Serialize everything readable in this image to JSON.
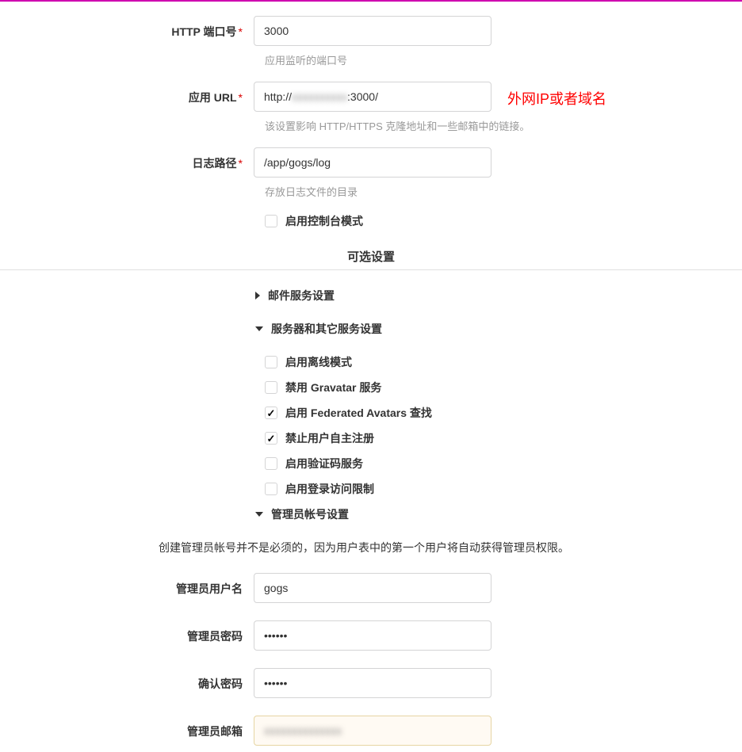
{
  "fields": {
    "http_port": {
      "label": "HTTP 端口号",
      "value": "3000",
      "help": "应用监听的端口号"
    },
    "app_url": {
      "label": "应用 URL",
      "prefix": "http://",
      "blurred": "xxxxxxxxxx",
      "suffix": ":3000/",
      "help": "该设置影响 HTTP/HTTPS 克隆地址和一些邮箱中的链接。",
      "annotation": "外网IP或者域名"
    },
    "log_path": {
      "label": "日志路径",
      "value": "/app/gogs/log",
      "help": "存放日志文件的目录"
    },
    "console_mode": {
      "label": "启用控制台模式"
    }
  },
  "optional_title": "可选设置",
  "sections": {
    "mail": {
      "label": "邮件服务设置"
    },
    "server": {
      "label": "服务器和其它服务设置"
    },
    "admin": {
      "label": "管理员帐号设置"
    }
  },
  "server_opts": [
    {
      "label": "启用离线模式",
      "checked": false
    },
    {
      "label": "禁用 Gravatar 服务",
      "checked": false
    },
    {
      "label": "启用 Federated Avatars 查找",
      "checked": true
    },
    {
      "label": "禁止用户自主注册",
      "checked": true
    },
    {
      "label": "启用验证码服务",
      "checked": false
    },
    {
      "label": "启用登录访问限制",
      "checked": false
    }
  ],
  "admin_note": "创建管理员帐号并不是必须的，因为用户表中的第一个用户将自动获得管理员权限。",
  "admin_fields": {
    "username": {
      "label": "管理员用户名",
      "value": "gogs"
    },
    "password": {
      "label": "管理员密码",
      "value": "••••••"
    },
    "confirm": {
      "label": "确认密码",
      "value": "••••••"
    },
    "email": {
      "label": "管理员邮箱",
      "blurred": "xxxxxxxxxxxxxx"
    }
  }
}
